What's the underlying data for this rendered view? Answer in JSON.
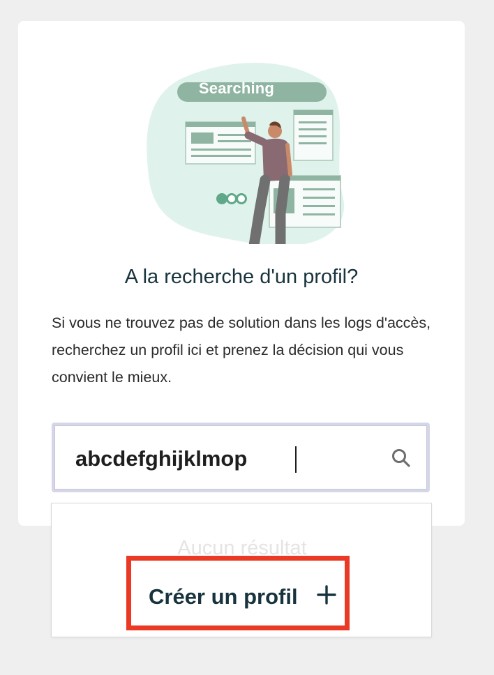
{
  "illustration": {
    "banner_text": "Searching",
    "icon": "person-searching-illustration"
  },
  "card": {
    "title": "A la recherche d'un profil?",
    "description": "Si vous ne trouvez pas de solution dans les logs d'accès, recherchez un profil ici et prenez la décision qui vous convient le mieux."
  },
  "search": {
    "value": "abcdefghijklmop",
    "icon": "search-icon"
  },
  "dropdown": {
    "no_result_text": "Aucun résultat",
    "create_label": "Créer un profil",
    "create_icon": "plus-icon"
  },
  "colors": {
    "background": "#efeff0",
    "title": "#17333d",
    "highlight_border": "#ea3a26",
    "illustration_mint": "#dff3ec",
    "illustration_green": "#8fb5a2"
  }
}
